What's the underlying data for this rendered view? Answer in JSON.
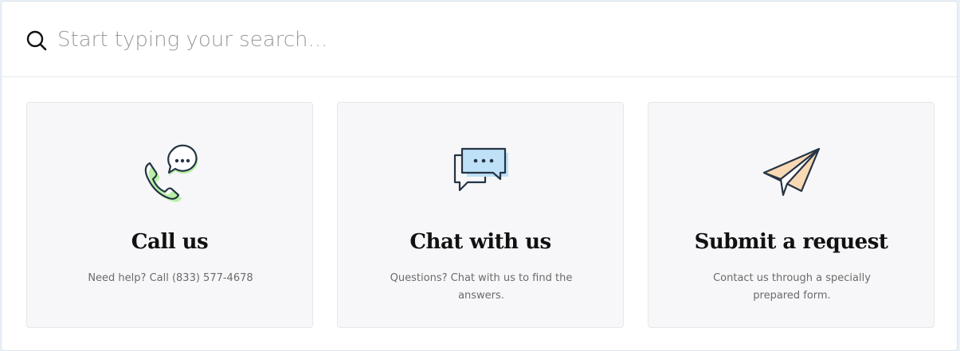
{
  "search": {
    "placeholder": "Start typing your search...",
    "icon": "search-icon"
  },
  "cards": [
    {
      "title": "Call us",
      "description": "Need help? Call (833) 577-4678",
      "icon": "phone-chat-icon",
      "accent": "#b8f0a6"
    },
    {
      "title": "Chat with us",
      "description": "Questions? Chat with us to find the answers.",
      "icon": "chat-bubbles-icon",
      "accent": "#bfe1f7"
    },
    {
      "title": "Submit a request",
      "description": "Contact us through a specially prepared form.",
      "icon": "paper-plane-icon",
      "accent": "#f9d9b4"
    }
  ],
  "colors": {
    "background": "#ffffff",
    "card_background": "#f7f7f9",
    "title_text": "#111111",
    "description_text": "#6b6b6b",
    "placeholder_text": "#9a9a9a",
    "icon_stroke": "#253444"
  }
}
